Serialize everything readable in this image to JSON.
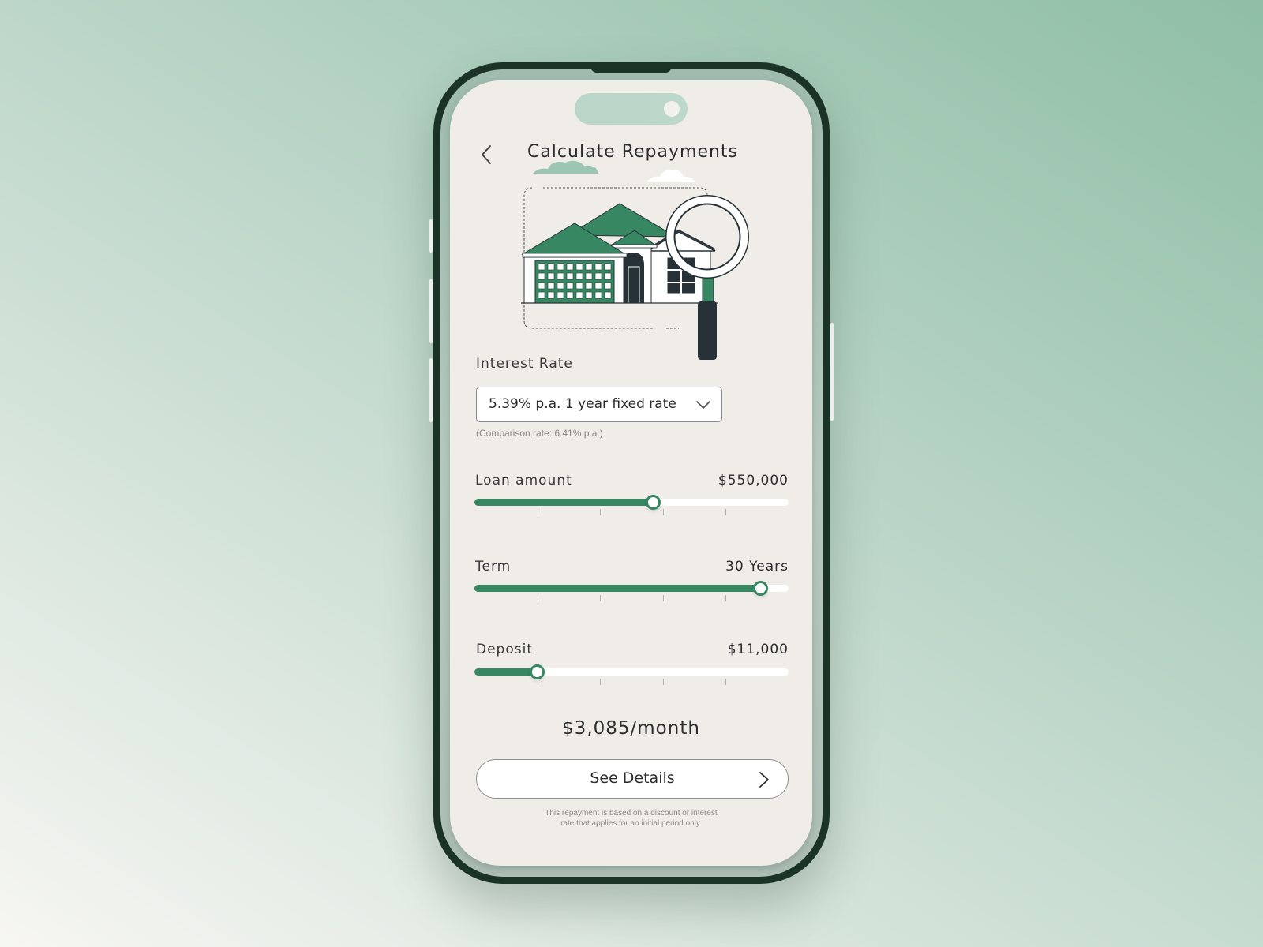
{
  "header": {
    "title": "Calculate Repayments",
    "back_icon": "chevron-left-icon"
  },
  "illustration": {
    "subject": "house-with-magnifying-glass",
    "colors": {
      "roof": "#378762",
      "dark": "#263238",
      "cloud": "#9cc5b2"
    }
  },
  "interest_rate": {
    "label": "Interest Rate",
    "selected": "5.39% p.a. 1 year fixed rate",
    "chevron_icon": "chevron-down-icon",
    "comparison": "(Comparison rate: 6.41% p.a.)"
  },
  "sliders": [
    {
      "id": "loan",
      "label": "Loan amount",
      "value": "$550,000",
      "fill_fraction": 0.57
    },
    {
      "id": "term",
      "label": "Term",
      "value": "30 Years",
      "fill_fraction": 0.91
    },
    {
      "id": "deposit",
      "label": "Deposit",
      "value": "$11,000",
      "fill_fraction": 0.2
    }
  ],
  "result": {
    "monthly": "$3,085/month"
  },
  "details_button": {
    "label": "See Details",
    "arrow_icon": "chevron-right-icon"
  },
  "footnote": {
    "line1": "This repayment is based on a discount or interest",
    "line2": "rate that applies for an initial period only."
  },
  "colors": {
    "accent": "#378762",
    "frame": "#1b3327",
    "screen_bg": "#f0ede9",
    "text": "#2d2d2d"
  }
}
